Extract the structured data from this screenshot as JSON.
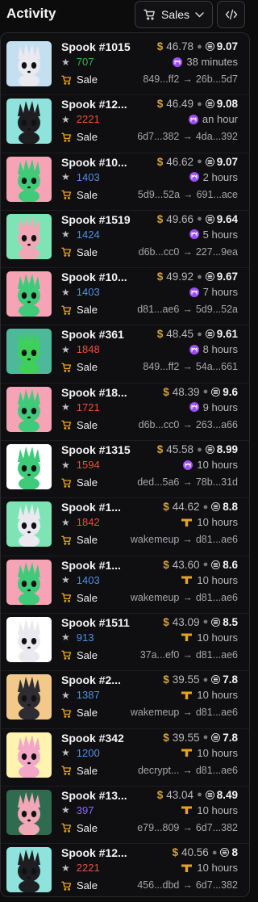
{
  "header": {
    "title": "Activity",
    "filter_label": "Sales"
  },
  "colors": {
    "usd": "#d4a13b",
    "rank_green": "#2fb84b",
    "rank_red": "#e9503f",
    "rank_blue": "#4f8fe8",
    "rank_purple": "#8b6cf0",
    "magic_eden": "#9d4ef2",
    "tensor": "#e8a31b"
  },
  "activity": [
    {
      "name": "Spook #1015",
      "rank": "707",
      "rank_color": "#2fb84b",
      "type": "Sale",
      "usd": "46.78",
      "native": "9.07",
      "time": "38 minutes",
      "marketplace": "magic-eden",
      "from": "849...ff2",
      "to": "26b...5d7",
      "bg": "#c4dff0",
      "icon_color": "#e9e9ef"
    },
    {
      "name": "Spook #12...",
      "rank": "2221",
      "rank_color": "#e9503f",
      "type": "Sale",
      "usd": "46.49",
      "native": "9.08",
      "time": "an hour",
      "marketplace": "magic-eden",
      "from": "6d7...382",
      "to": "4da...392",
      "bg": "#8fe3dc",
      "icon_color": "#1e1e22"
    },
    {
      "name": "Spook #10...",
      "rank": "1403",
      "rank_color": "#4f8fe8",
      "type": "Sale",
      "usd": "46.62",
      "native": "9.07",
      "time": "2 hours",
      "marketplace": "magic-eden",
      "from": "5d9...52a",
      "to": "691...ace",
      "bg": "#f7a3b6",
      "icon_color": "#3fcb7a"
    },
    {
      "name": "Spook #1519",
      "rank": "1424",
      "rank_color": "#4f8fe8",
      "type": "Sale",
      "usd": "49.66",
      "native": "9.64",
      "time": "5 hours",
      "marketplace": "magic-eden",
      "from": "d6b...cc0",
      "to": "227...9ea",
      "bg": "#7fe4b5",
      "icon_color": "#f2a7b7"
    },
    {
      "name": "Spook #10...",
      "rank": "1403",
      "rank_color": "#4f8fe8",
      "type": "Sale",
      "usd": "49.92",
      "native": "9.67",
      "time": "7 hours",
      "marketplace": "magic-eden",
      "from": "d81...ae6",
      "to": "5d9...52a",
      "bg": "#f7a3b6",
      "icon_color": "#3fcb7a"
    },
    {
      "name": "Spook #361",
      "rank": "1848",
      "rank_color": "#e9503f",
      "type": "Sale",
      "usd": "48.45",
      "native": "9.61",
      "time": "8 hours",
      "marketplace": "magic-eden",
      "from": "849...ff2",
      "to": "54a...661",
      "bg": "#4db99a",
      "icon_color": "#3ed05a"
    },
    {
      "name": "Spook #18...",
      "rank": "1721",
      "rank_color": "#e9503f",
      "type": "Sale",
      "usd": "48.39",
      "native": "9.6",
      "time": "9 hours",
      "marketplace": "magic-eden",
      "from": "d6b...cc0",
      "to": "263...a66",
      "bg": "#f7a3b6",
      "icon_color": "#3fcb7a"
    },
    {
      "name": "Spook #1315",
      "rank": "1594",
      "rank_color": "#e9503f",
      "type": "Sale",
      "usd": "45.58",
      "native": "8.99",
      "time": "10 hours",
      "marketplace": "magic-eden",
      "from": "ded...5a6",
      "to": "78b...31d",
      "bg": "#ffffff",
      "icon_color": "#3fcb7a"
    },
    {
      "name": "Spook #1...",
      "rank": "1842",
      "rank_color": "#e9503f",
      "type": "Sale",
      "usd": "44.62",
      "native": "8.8",
      "time": "10 hours",
      "marketplace": "tensor",
      "from": "wakemeup",
      "to": "d81...ae6",
      "bg": "#7fe4b5",
      "icon_color": "#e9e9ef"
    },
    {
      "name": "Spook #1...",
      "rank": "1403",
      "rank_color": "#4f8fe8",
      "type": "Sale",
      "usd": "43.60",
      "native": "8.6",
      "time": "10 hours",
      "marketplace": "tensor",
      "from": "wakemeup",
      "to": "d81...ae6",
      "bg": "#f7a3b6",
      "icon_color": "#3fcb7a"
    },
    {
      "name": "Spook #1511",
      "rank": "913",
      "rank_color": "#4f8fe8",
      "type": "Sale",
      "usd": "43.09",
      "native": "8.5",
      "time": "10 hours",
      "marketplace": "tensor",
      "from": "37a...ef0",
      "to": "d81...ae6",
      "bg": "#ffffff",
      "icon_color": "#e9e9ef"
    },
    {
      "name": "Spook #2...",
      "rank": "1387",
      "rank_color": "#4f8fe8",
      "type": "Sale",
      "usd": "39.55",
      "native": "7.8",
      "time": "10 hours",
      "marketplace": "tensor",
      "from": "wakemeup",
      "to": "d81...ae6",
      "bg": "#f3c88b",
      "icon_color": "#2d2d33"
    },
    {
      "name": "Spook #342",
      "rank": "1200",
      "rank_color": "#4f8fe8",
      "type": "Sale",
      "usd": "39.55",
      "native": "7.8",
      "time": "10 hours",
      "marketplace": "tensor",
      "from": "decrypt...",
      "to": "d81...ae6",
      "bg": "#fff3b0",
      "icon_color": "#f2a7c7"
    },
    {
      "name": "Spook #13...",
      "rank": "397",
      "rank_color": "#8b6cf0",
      "type": "Sale",
      "usd": "43.04",
      "native": "8.49",
      "time": "10 hours",
      "marketplace": "tensor",
      "from": "e79...809",
      "to": "6d7...382",
      "bg": "#2e6b4f",
      "icon_color": "#f2a7b7"
    },
    {
      "name": "Spook #12...",
      "rank": "2221",
      "rank_color": "#e9503f",
      "type": "Sale",
      "usd": "40.56",
      "native": "8",
      "time": "10 hours",
      "marketplace": "tensor",
      "from": "456...dbd",
      "to": "6d7...382",
      "bg": "#8fe3dc",
      "icon_color": "#1e1e22"
    }
  ]
}
